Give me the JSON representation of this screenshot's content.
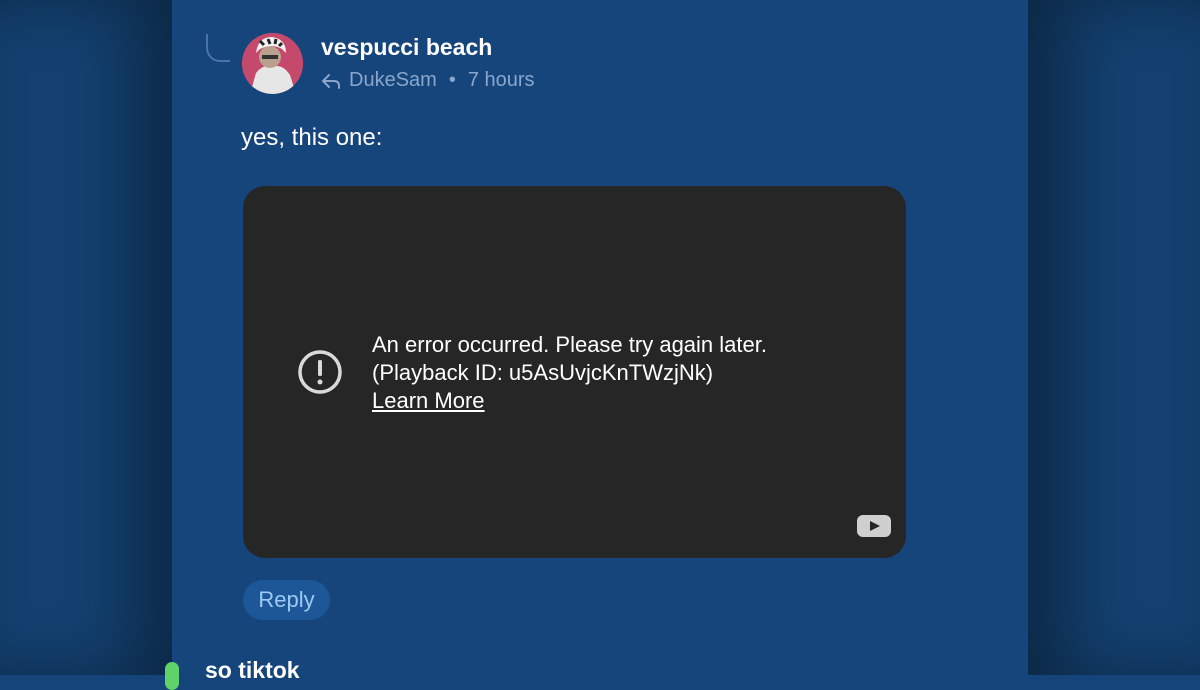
{
  "post": {
    "author": "vespucci beach",
    "reply_to": "DukeSam",
    "separator": "•",
    "time": "7 hours",
    "body": "yes, this one:"
  },
  "video": {
    "error_line1": "An error occurred. Please try again later.",
    "error_line2": "(Playback ID: u5AsUvjcKnTWzjNk)",
    "learn_more": "Learn More",
    "icon_error": "error-circle-icon",
    "icon_logo": "youtube-icon"
  },
  "actions": {
    "reply_label": "Reply"
  },
  "next_post": {
    "preview": "so tiktok"
  },
  "colors": {
    "background": "#16457c",
    "video_bg": "#262626",
    "reply_btn_bg": "#1e5797",
    "reply_btn_text": "#9ccaf5",
    "meta_text": "#8aa6cc"
  }
}
